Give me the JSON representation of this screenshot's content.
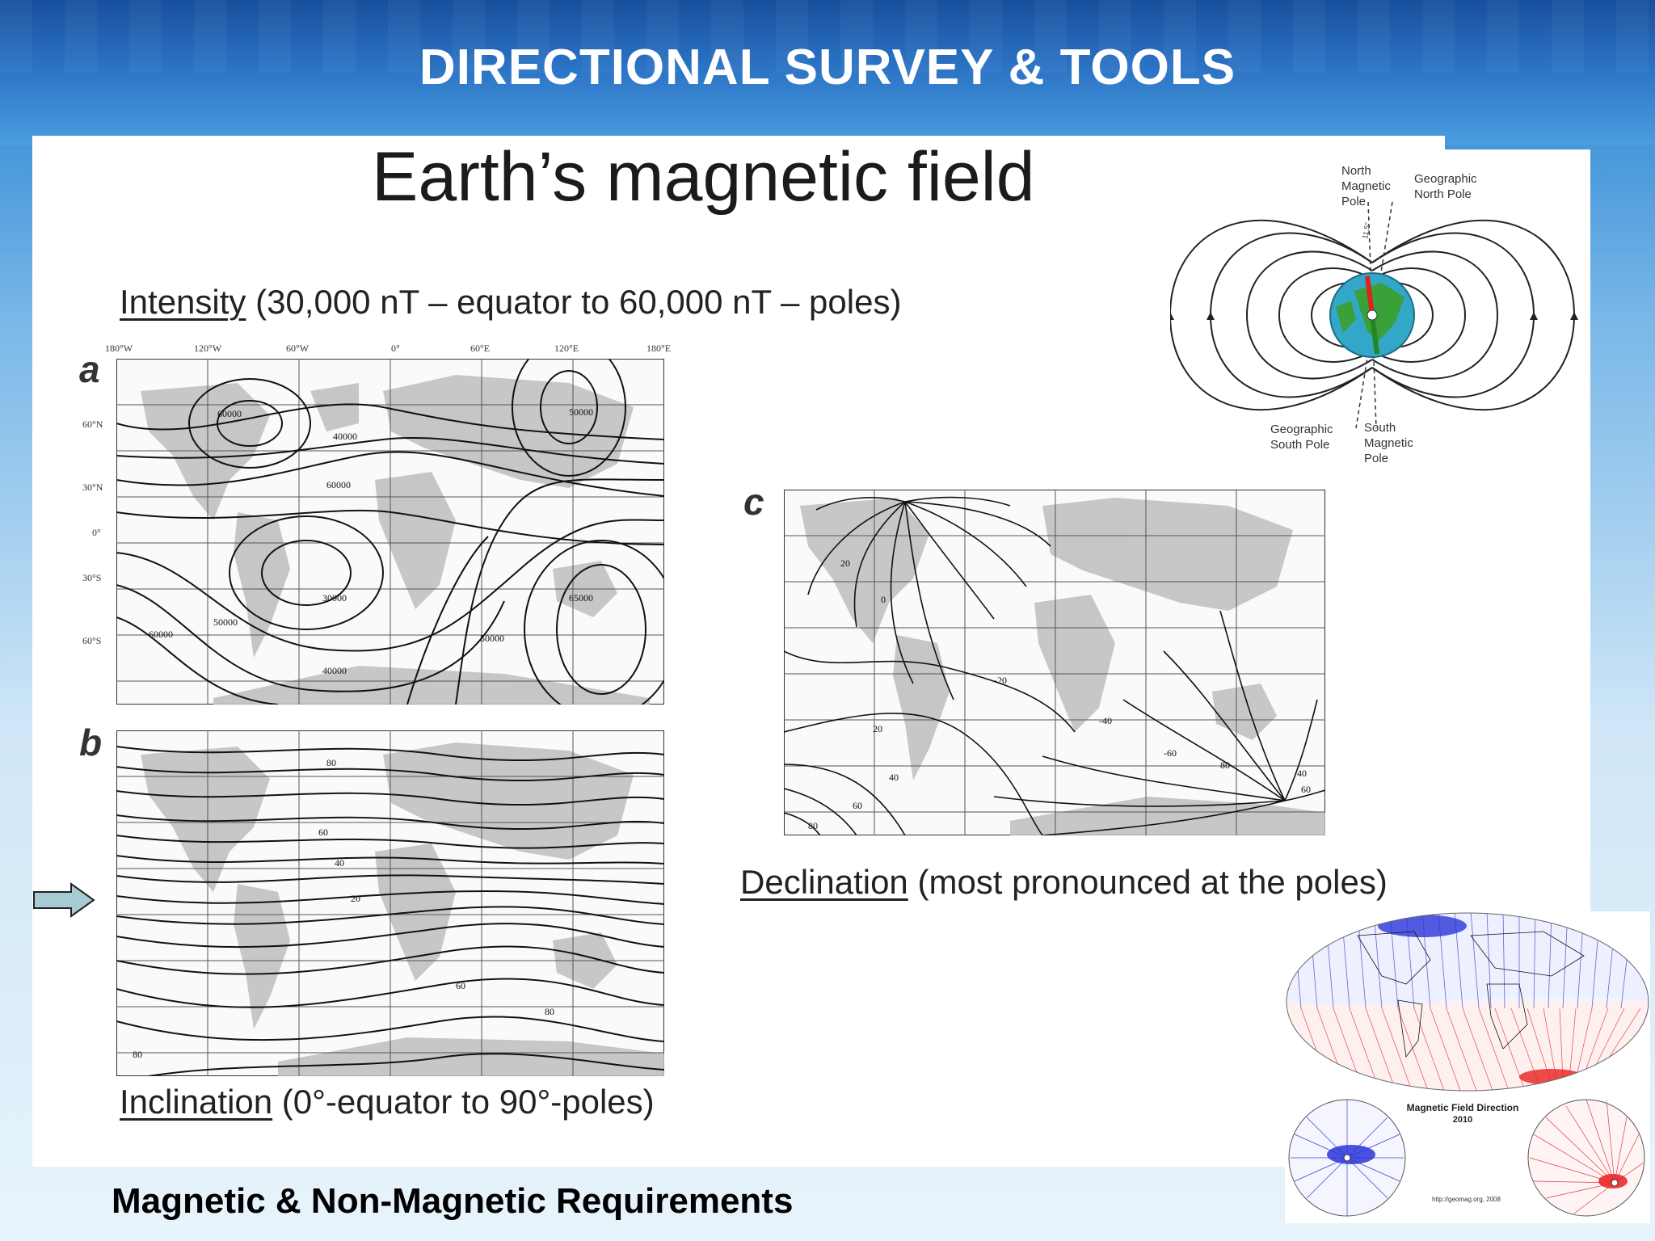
{
  "header": {
    "title": "DIRECTIONAL SURVEY & TOOLS"
  },
  "slide": {
    "title": "Earth’s magnetic field",
    "intensity_caption": {
      "term": "Intensity",
      "rest": " (30,000 nT – equator to 60,000 nT – poles)"
    },
    "inclination_caption": {
      "term": "Inclination",
      "rest": " (0°-equator to 90°-poles)"
    },
    "declination_caption": {
      "term": "Declination",
      "rest": " (most pronounced at the poles)"
    }
  },
  "maps": {
    "a": {
      "letter": "a",
      "lon_ticks": [
        "180°W",
        "120°W",
        "60°W",
        "0°",
        "60°E",
        "120°E",
        "180°E"
      ],
      "lat_ticks": [
        "60°N",
        "30°N",
        "0°",
        "30°S",
        "60°S"
      ],
      "contour_labels": [
        "60000",
        "50000",
        "40000",
        "30000",
        "60000",
        "50000",
        "65000",
        "50000",
        "40000",
        "60000"
      ]
    },
    "b": {
      "letter": "b",
      "contour_labels": [
        "80",
        "60",
        "40",
        "20",
        "60",
        "80",
        "80"
      ]
    },
    "c": {
      "letter": "c",
      "contour_labels": [
        "20",
        "0",
        "-20",
        "-40",
        "-60",
        "20",
        "40",
        "60",
        "80",
        "40",
        "60",
        "80"
      ]
    }
  },
  "dipole_diagram": {
    "north_magnetic": [
      "North",
      "Magnetic",
      "Pole"
    ],
    "geographic_north": [
      "Geographic",
      "North Pole"
    ],
    "geographic_south": [
      "Geographic",
      "South Pole"
    ],
    "south_magnetic": [
      "South",
      "Magnetic",
      "Pole"
    ],
    "tilt_label": "11.5°"
  },
  "inset": {
    "title": "Magnetic Field Direction",
    "year": "2010",
    "url": "http://geomag.org, 2008"
  },
  "footer": {
    "text": "Magnetic & Non-Magnetic Requirements"
  },
  "icons": {
    "arrow": "right-arrow-icon"
  },
  "colors": {
    "header_blue": "#2a72c4",
    "field_blue": "#1f3fd0",
    "field_red": "#e02020"
  }
}
